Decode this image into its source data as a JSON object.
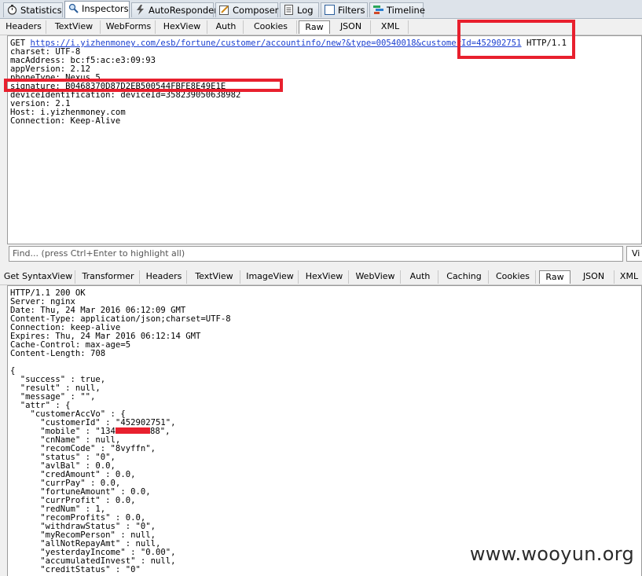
{
  "main_tabs": [
    {
      "label": "Statistics",
      "icon": "stopwatch-icon"
    },
    {
      "label": "Inspectors",
      "icon": "magnifier-icon"
    },
    {
      "label": "AutoResponder",
      "icon": "lightning-icon"
    },
    {
      "label": "Composer",
      "icon": "pencil-icon"
    },
    {
      "label": "Log",
      "icon": "log-icon"
    },
    {
      "label": "Filters",
      "icon": "checkbox-icon"
    },
    {
      "label": "Timeline",
      "icon": "timeline-icon"
    }
  ],
  "request_tabs": [
    "Headers",
    "TextView",
    "WebForms",
    "HexView",
    "Auth",
    "Cookies",
    "Raw",
    "JSON",
    "XML"
  ],
  "request": {
    "method": "GET ",
    "url_part1": "https://i.yizhenmoney.com/esb/fortune/customer/accountinfo/new?&type=00540018",
    "url_part2": "&customerId=452902751",
    "protocol": " HTTP/1.1",
    "lines": [
      "charset: UTF-8",
      "macAddress: bc:f5:ac:e3:09:93",
      "appVersion: 2.12",
      "phoneType: Nexus 5",
      "signature: B0468370D87D2EB500544FBFE8E49E1E",
      "deviceIdentification: deviceId=358239050638982",
      "version: 2.1",
      "Host: i.yizhenmoney.com",
      "Connection: Keep-Alive"
    ]
  },
  "find": {
    "placeholder": "Find... (press Ctrl+Enter to highlight all)",
    "button": "Vi"
  },
  "response_tabs": [
    "Get SyntaxView",
    "Transformer",
    "Headers",
    "TextView",
    "ImageView",
    "HexView",
    "WebView",
    "Auth",
    "Caching",
    "Cookies",
    "Raw",
    "JSON",
    "XML"
  ],
  "response": {
    "headers": [
      "HTTP/1.1 200 OK",
      "Server: nginx",
      "Date: Thu, 24 Mar 2016 06:12:09 GMT",
      "Content-Type: application/json;charset=UTF-8",
      "Connection: keep-alive",
      "Expires: Thu, 24 Mar 2016 06:12:14 GMT",
      "Cache-Control: max-age=5",
      "Content-Length: 708"
    ],
    "body_before_mobile": [
      "{",
      "  \"success\" : true,",
      "  \"result\" : null,",
      "  \"message\" : \"\",",
      "  \"attr\" : {",
      "    \"customerAccVo\" : {",
      "      \"customerId\" : \"452902751\","
    ],
    "mobile_prefix": "      \"mobile\" : \"134",
    "mobile_suffix": "88\",",
    "body_after_mobile": [
      "      \"cnName\" : null,",
      "      \"recomCode\" : \"8vyffn\",",
      "      \"status\" : \"0\",",
      "      \"avlBal\" : 0.0,",
      "      \"credAmount\" : 0.0,",
      "      \"currPay\" : 0.0,",
      "      \"fortuneAmount\" : 0.0,",
      "      \"currProfit\" : 0.0,",
      "      \"redNum\" : 1,",
      "      \"recomProfits\" : 0.0,",
      "      \"withdrawStatus\" : \"0\",",
      "      \"myRecomPerson\" : null,",
      "      \"allNotRepayAmt\" : null,",
      "      \"yesterdayIncome\" : \"0.00\",",
      "      \"accumulatedInvest\" : null,",
      "      \"creditStatus\" : \"0\""
    ]
  },
  "watermark": "www.wooyun.org",
  "colors": {
    "highlight_box": "#e8202e",
    "link": "#1a3fd0"
  }
}
